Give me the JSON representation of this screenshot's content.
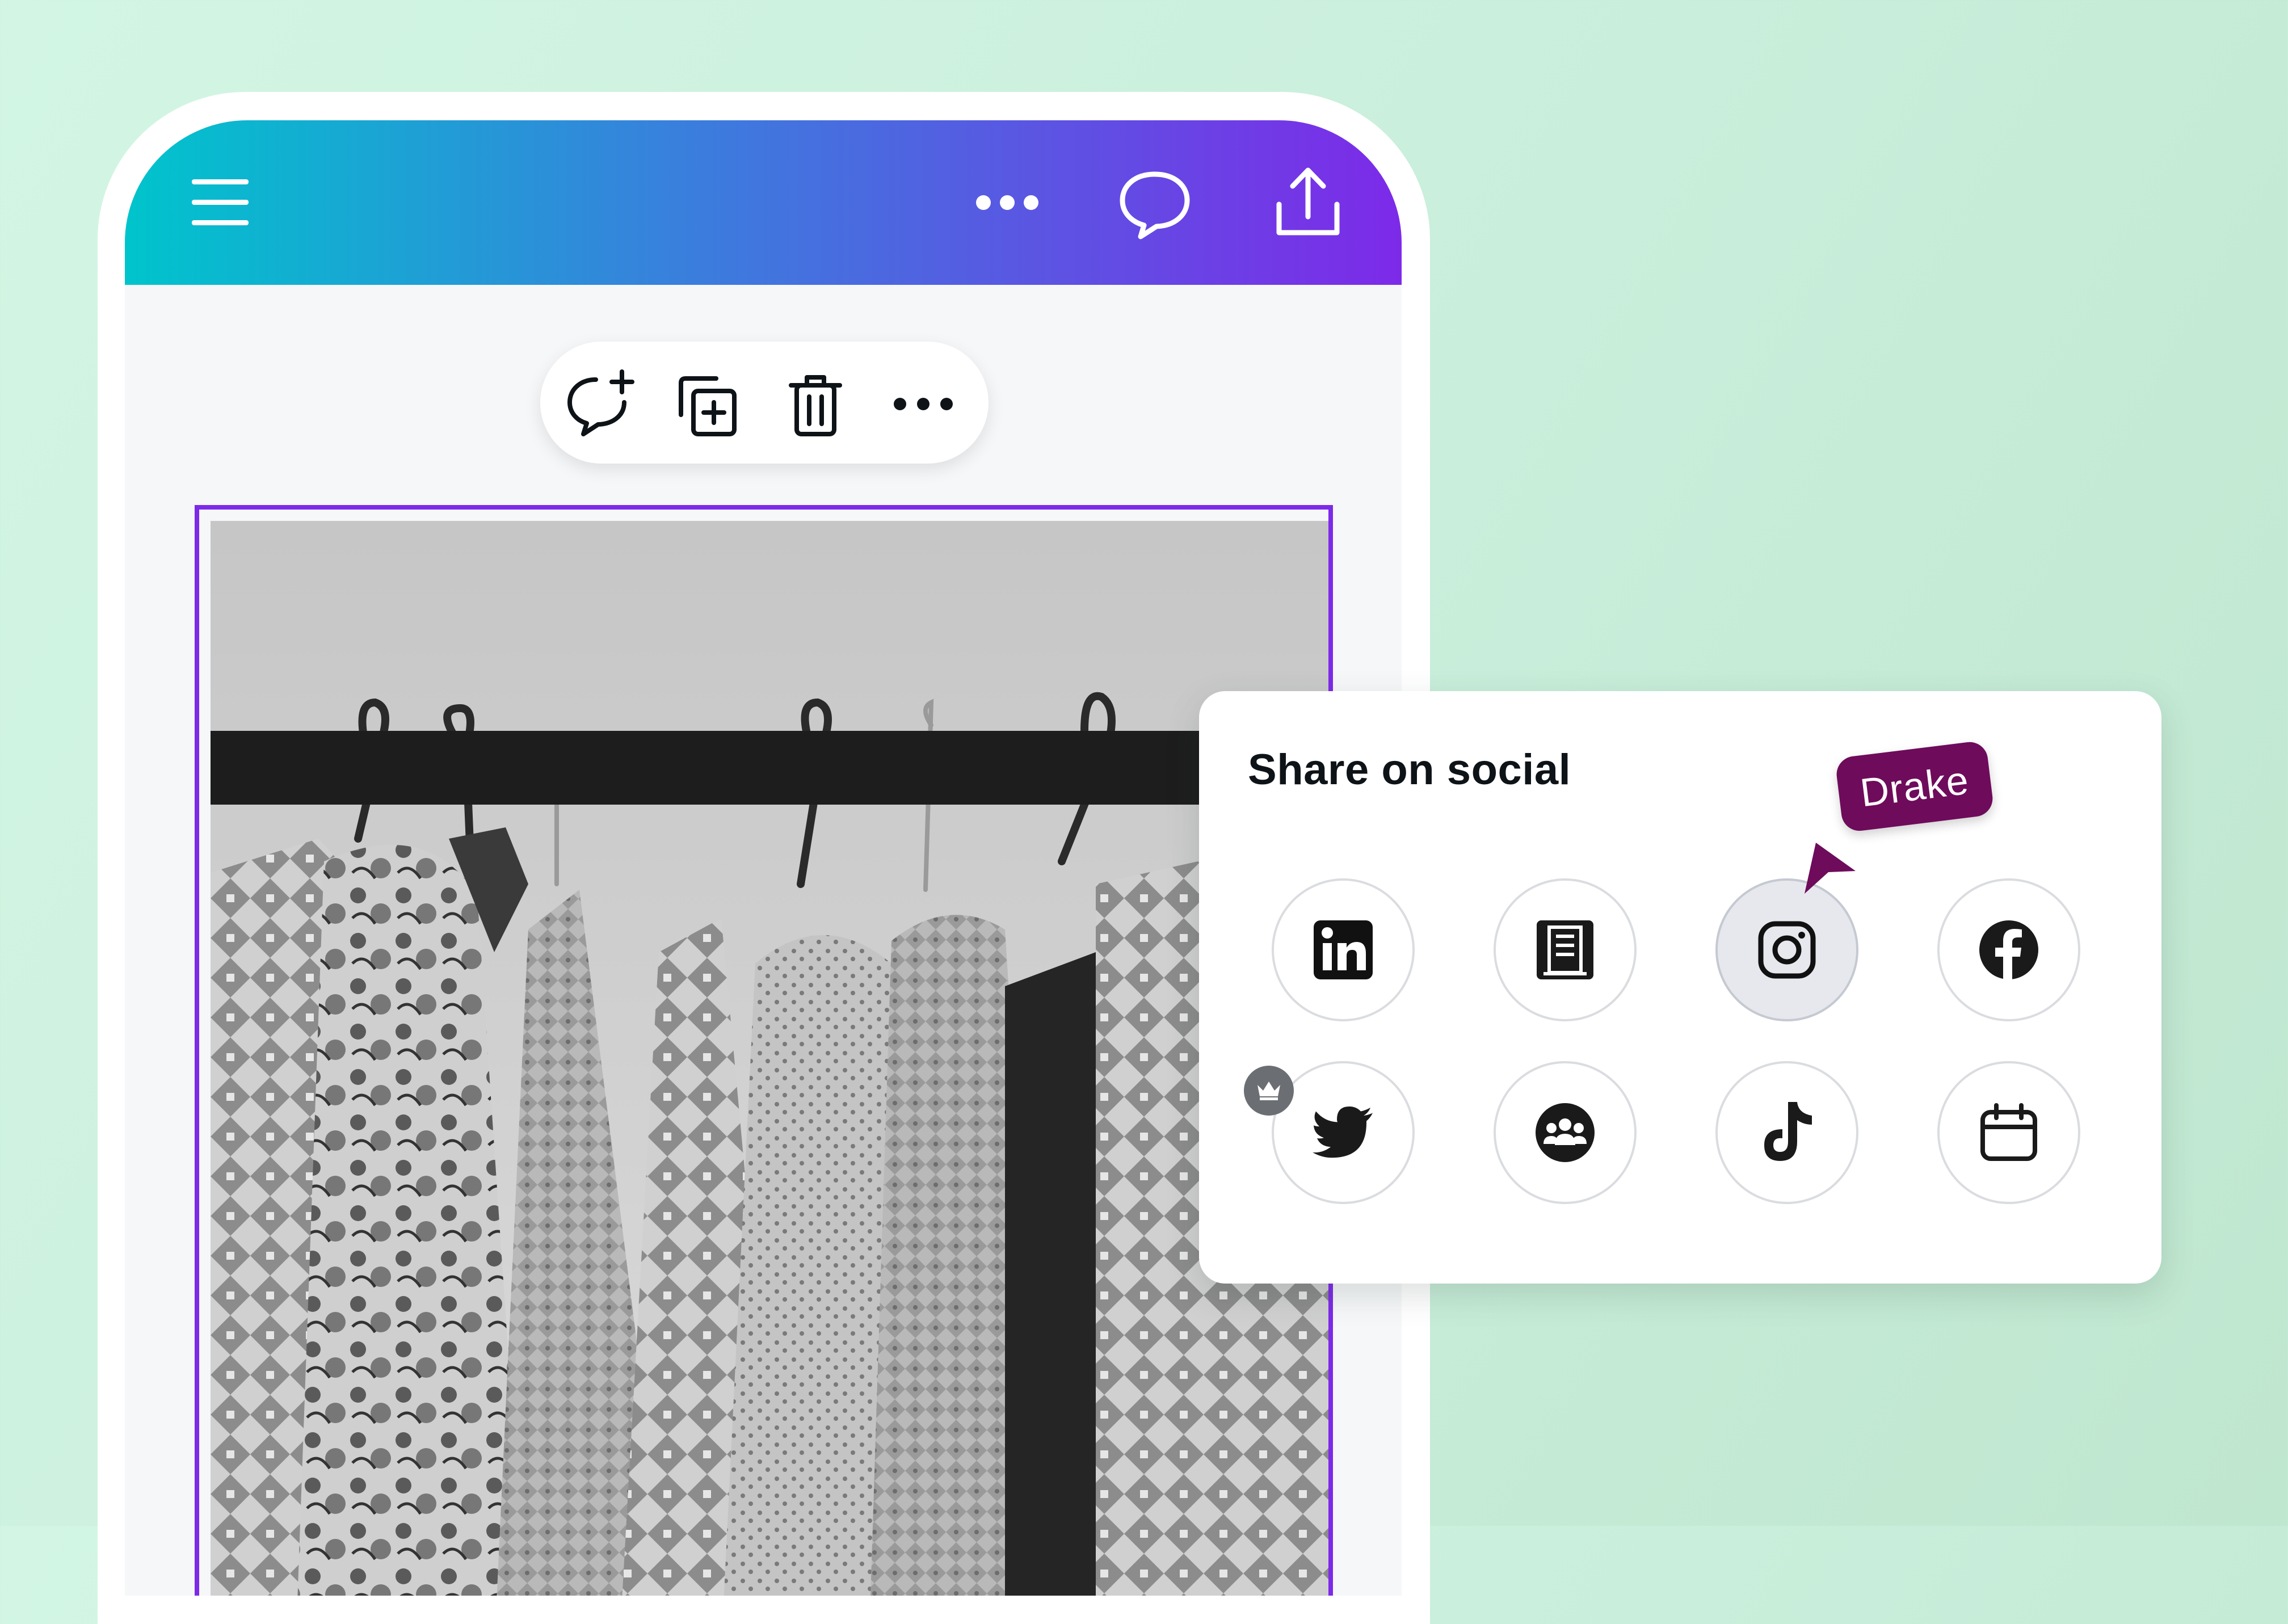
{
  "panel": {
    "title": "Share on social",
    "items": [
      {
        "name": "LinkedIn",
        "icon": "linkedin-icon"
      },
      {
        "name": "Page",
        "icon": "building-page-icon"
      },
      {
        "name": "Instagram",
        "icon": "instagram-icon",
        "selected": true
      },
      {
        "name": "Facebook",
        "icon": "facebook-icon"
      },
      {
        "name": "Twitter",
        "icon": "twitter-icon"
      },
      {
        "name": "Group",
        "icon": "group-icon"
      },
      {
        "name": "TikTok",
        "icon": "tiktok-icon"
      },
      {
        "name": "Schedule",
        "icon": "calendar-icon",
        "premium": true
      }
    ]
  },
  "collaborator": {
    "name": "Drake",
    "color": "#6e0b5b"
  },
  "topbar": {
    "icons": [
      "menu-icon",
      "more-icon",
      "comment-icon",
      "share-icon"
    ]
  },
  "toolbar": {
    "icons": [
      "add-comment-icon",
      "duplicate-icon",
      "trash-icon",
      "more-icon"
    ]
  },
  "colors": {
    "accent": "#7d2ae8",
    "gradient_start": "#00c4cc",
    "gradient_end": "#7d2ae8"
  }
}
